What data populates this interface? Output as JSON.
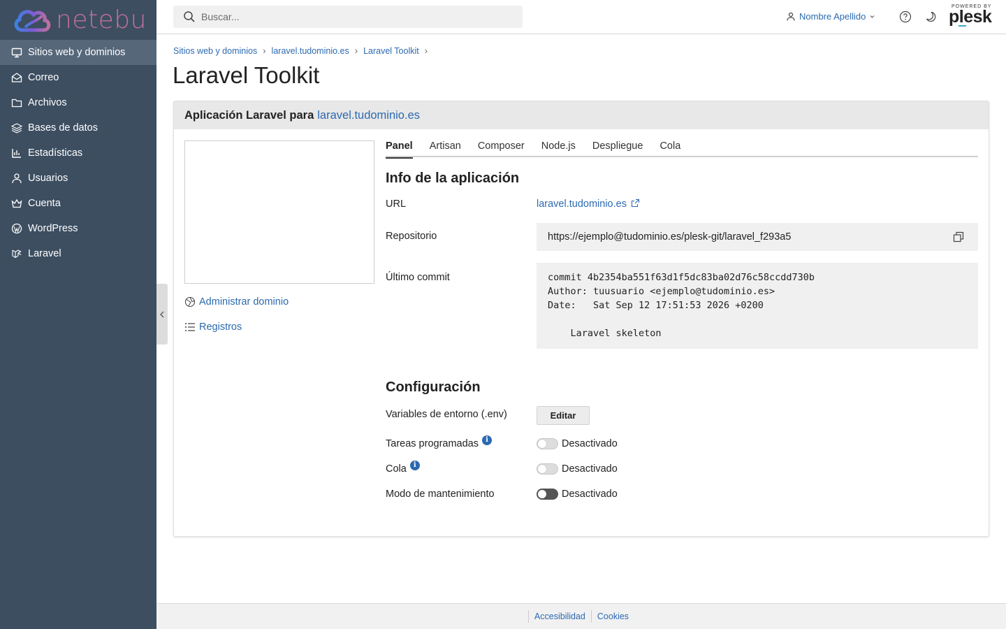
{
  "brand": {
    "name": "netebu"
  },
  "sidebar": {
    "items": [
      {
        "label": "Sitios web y dominios",
        "icon": "monitor-icon"
      },
      {
        "label": "Correo",
        "icon": "mail-icon"
      },
      {
        "label": "Archivos",
        "icon": "folder-icon"
      },
      {
        "label": "Bases de datos",
        "icon": "database-icon"
      },
      {
        "label": "Estadísticas",
        "icon": "chart-icon"
      },
      {
        "label": "Usuarios",
        "icon": "user-icon"
      },
      {
        "label": "Cuenta",
        "icon": "account-icon"
      },
      {
        "label": "WordPress",
        "icon": "wordpress-icon"
      },
      {
        "label": "Laravel",
        "icon": "laravel-icon"
      }
    ]
  },
  "header": {
    "search_placeholder": "Buscar...",
    "user_name": "Nombre Apellido",
    "plesk_powered": "POWERED BY",
    "plesk_name": "plesk"
  },
  "breadcrumb": [
    "Sitios web y dominios",
    "laravel.tudominio.es",
    "Laravel Toolkit"
  ],
  "page_title": "Laravel Toolkit",
  "card": {
    "heading_prefix": "Aplicación Laravel para",
    "heading_domain": "laravel.tudominio.es",
    "side_links": {
      "manage_domain": "Administrar dominio",
      "logs": "Registros"
    },
    "tabs": [
      "Panel",
      "Artisan",
      "Composer",
      "Node.js",
      "Despliegue",
      "Cola"
    ],
    "info": {
      "title": "Info de la aplicación",
      "url_label": "URL",
      "url_value": "laravel.tudominio.es",
      "repo_label": "Repositorio",
      "repo_value": "https://ejemplo@tudominio.es/plesk-git/laravel_f293a5",
      "commit_label": "Último commit",
      "commit_value": "commit 4b2354ba551f63d1f5dc83ba02d76c58ccdd730b\nAuthor: tuusuario <ejemplo@tudominio.es>\nDate:   Sat Sep 12 17:51:53 2026 +0200\n\n    Laravel skeleton"
    },
    "config": {
      "title": "Configuración",
      "env_label": "Variables de entorno (.env)",
      "edit_button": "Editar",
      "scheduled_label": "Tareas programadas",
      "scheduled_state": "Desactivado",
      "queue_label": "Cola",
      "queue_state": "Desactivado",
      "maintenance_label": "Modo de mantenimiento",
      "maintenance_state": "Desactivado"
    }
  },
  "footer": {
    "accessibility": "Accesibilidad",
    "cookies": "Cookies"
  },
  "colors": {
    "sidebar": "#3d4e61",
    "sidebar_active": "#56677a",
    "link": "#2c6ab0",
    "brand": "#c0709e"
  }
}
